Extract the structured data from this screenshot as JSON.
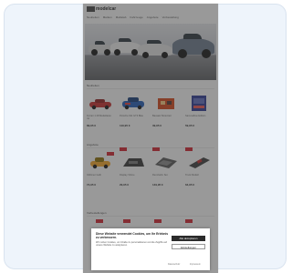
{
  "site": {
    "logo_text": "modelcar",
    "nav": [
      "Neuheiten",
      "Marken",
      "Maßstab",
      "Fahrzeuge",
      "Angebote",
      "Vorbestellung"
    ]
  },
  "sections": {
    "new_arrivals": "Neuheiten",
    "offers": "Angebote",
    "more": "Vorbestellungen"
  },
  "products_row1": [
    {
      "name": "Ferrari 1:18 Modellauto rot",
      "price": "89,95 €",
      "color": "#c62828"
    },
    {
      "name": "Porsche 911 GT3 Blau",
      "price": "119,95 €",
      "color": "#1e5bb8"
    },
    {
      "name": "Bausatz Motorrad",
      "price": "39,95 €",
      "color": "#d84315"
    },
    {
      "name": "Sammelbox Edition",
      "price": "59,95 €",
      "color": "#283593"
    }
  ],
  "products_row2": [
    {
      "name": "Oldtimer Gelb",
      "price": "74,95 €",
      "color": "#f9a825",
      "sale": true
    },
    {
      "name": "Display Vitrine",
      "price": "29,95 €",
      "color": "#333333",
      "sale": true
    },
    {
      "name": "Rennbahn Set",
      "price": "149,95 €",
      "color": "#555555",
      "sale": true
    },
    {
      "name": "Truck Modell",
      "price": "64,95 €",
      "color": "#3a3a3a",
      "sale": true
    }
  ],
  "cookie": {
    "title": "Diese Website verwendet Cookies, um Ihr Erlebnis zu verbessern.",
    "text": "Wir nutzen Cookies, um Inhalte zu personalisieren und die Zugriffe auf unsere Website zu analysieren.",
    "accept_label": "Alle akzeptieren",
    "settings_label": "Einstellungen",
    "link_privacy": "Datenschutz",
    "link_imprint": "Impressum"
  },
  "colors": {
    "accent_red": "#d41f2b",
    "background_card": "#eef4fb"
  }
}
